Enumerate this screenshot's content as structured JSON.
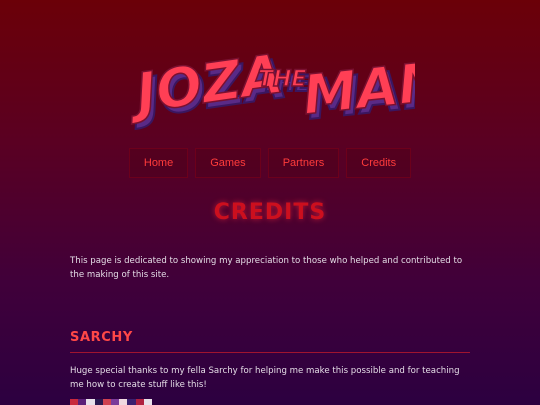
{
  "logo": {
    "text": "JOZATHEMAN",
    "part_main_1": "JOZA",
    "part_small": "THE",
    "part_main_2": "MAN"
  },
  "nav": {
    "items": [
      {
        "label": "Home"
      },
      {
        "label": "Games"
      },
      {
        "label": "Partners"
      },
      {
        "label": "Credits"
      }
    ]
  },
  "page": {
    "title": "CREDITS",
    "intro": "This page is dedicated to showing my appreciation to those who helped and contributed to the making of this site."
  },
  "sections": [
    {
      "title": "SARCHY",
      "text": "Huge special thanks to my fella Sarchy for helping me make this possible and for teaching me how to create stuff like this!"
    }
  ],
  "colors": {
    "accent": "#ff3b3b",
    "title_red": "#cc0f1e",
    "logo_fill": "#ff3f55",
    "logo_shadow": "#6b2a8c"
  }
}
